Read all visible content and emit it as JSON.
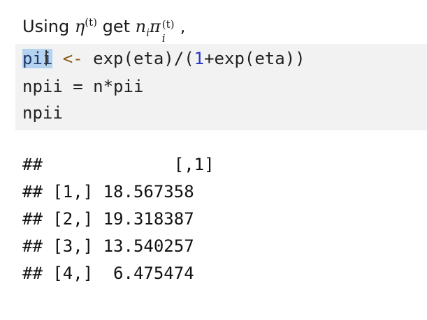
{
  "prose": {
    "using": "Using",
    "eta": "η",
    "eta_sup": "(t)",
    "get": "get",
    "n": "n",
    "n_sub": "i",
    "pi": "π",
    "pi_sup": "(t)",
    "pi_sub": "i",
    "trail": ","
  },
  "code": {
    "line1": {
      "selected": "pii",
      "assign": " <- ",
      "part_a": "exp(eta)/(",
      "one": "1",
      "part_b": "+exp(eta))"
    },
    "line2": "npii = n*pii",
    "line3": "npii"
  },
  "output": {
    "lines": [
      "##             [,1]",
      "## [1,] 18.567358",
      "## [2,] 19.318387",
      "## [3,] 13.540257",
      "## [4,]  6.475474"
    ]
  },
  "colors": {
    "code_background": "#f2f2f2",
    "selection": "#b5d3ef",
    "operator": "#8a5a17",
    "number": "#2a35c8"
  }
}
